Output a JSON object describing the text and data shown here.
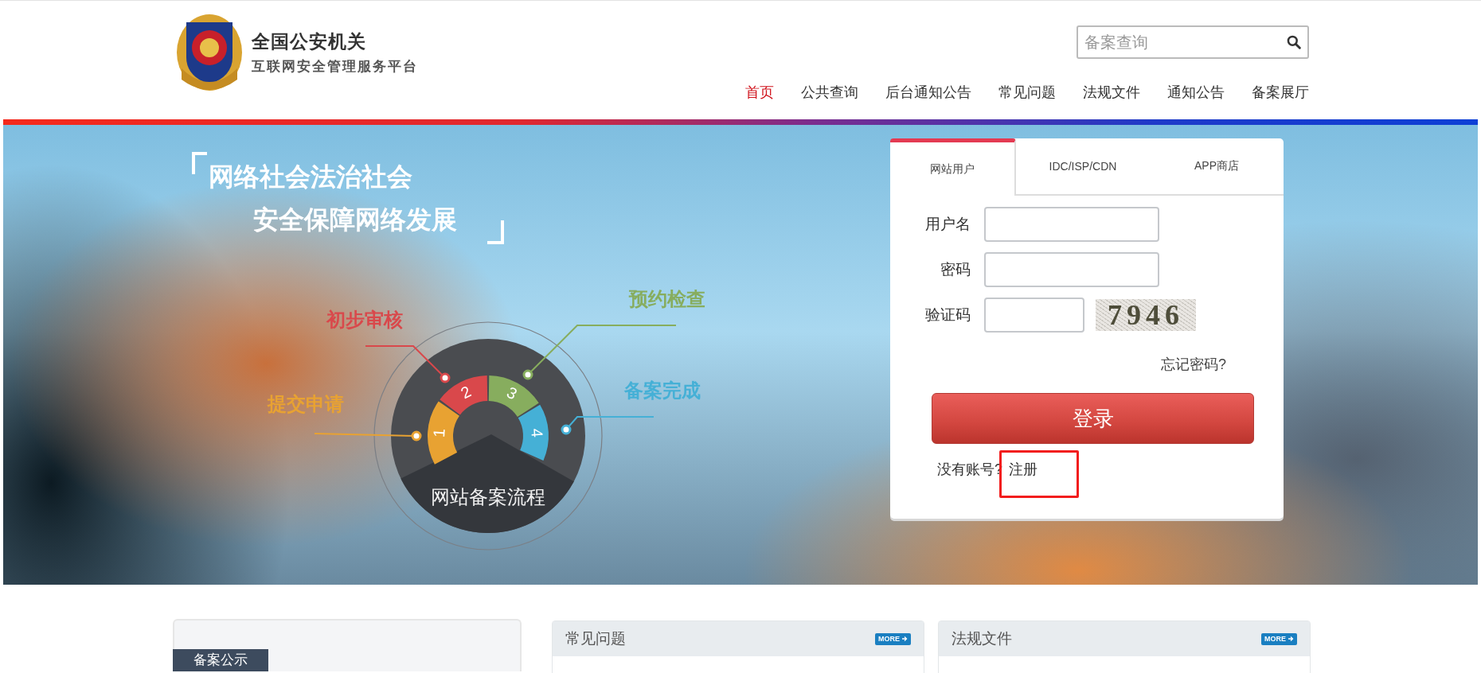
{
  "header": {
    "logo_title": "全国公安机关",
    "logo_subtitle": "互联网安全管理服务平台",
    "search": {
      "placeholder": "备案查询"
    }
  },
  "nav": [
    {
      "label": "首页",
      "selected": true
    },
    {
      "label": "公共查询",
      "selected": false
    },
    {
      "label": "后台通知公告",
      "selected": false
    },
    {
      "label": "常见问题",
      "selected": false
    },
    {
      "label": "法规文件",
      "selected": false
    },
    {
      "label": "通知公告",
      "selected": false
    },
    {
      "label": "备案展厅",
      "selected": false
    }
  ],
  "hero": {
    "slogan_lines": [
      "网络社会法治社会",
      "安全保障网络发展"
    ],
    "process": {
      "title": "网站备案流程",
      "steps": [
        {
          "number": "1",
          "label": "提交申请",
          "color": "#e8a232"
        },
        {
          "number": "2",
          "label": "初步审核",
          "color": "#d9484b"
        },
        {
          "number": "3",
          "label": "预约检查",
          "color": "#87ad5e"
        },
        {
          "number": "4",
          "label": "备案完成",
          "color": "#45b0d6"
        }
      ]
    }
  },
  "login": {
    "tabs": [
      {
        "label": "网站用户",
        "selected": true
      },
      {
        "label": "IDC/ISP/CDN",
        "selected": false
      },
      {
        "label": "APP商店",
        "selected": false
      }
    ],
    "fields": [
      {
        "label": "用户名",
        "kind": "text"
      },
      {
        "label": "密码",
        "kind": "password"
      },
      {
        "label": "验证码",
        "kind": "captcha",
        "captcha": "7946"
      }
    ],
    "forgot": "忘记密码?",
    "submit": "登录",
    "register_prompt": "没有账号?",
    "register_link": "注册",
    "register_highlighted": true
  },
  "sections": [
    {
      "title": "备案公示",
      "kind": "tab"
    },
    {
      "title": "常见问题",
      "kind": "panel",
      "more": "MORE"
    },
    {
      "title": "法规文件",
      "kind": "panel",
      "more": "MORE"
    }
  ]
}
